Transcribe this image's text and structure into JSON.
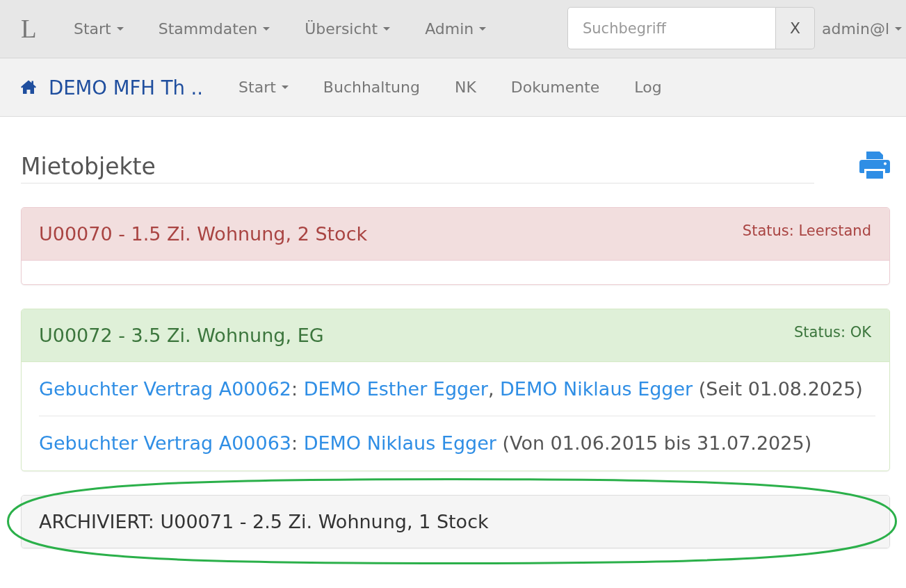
{
  "top_navbar": {
    "brand": "L",
    "items": [
      {
        "label": "Start",
        "dropdown": true
      },
      {
        "label": "Stammdaten",
        "dropdown": true
      },
      {
        "label": "Übersicht",
        "dropdown": true
      },
      {
        "label": "Admin",
        "dropdown": true
      }
    ],
    "search": {
      "placeholder": "Suchbegriff",
      "button": "X"
    },
    "user_menu": {
      "label": "admin@l",
      "dropdown": true
    }
  },
  "project_navbar": {
    "brand": "DEMO MFH Th ..",
    "items": [
      {
        "label": "Start",
        "dropdown": true
      },
      {
        "label": "Buchhaltung",
        "dropdown": false
      },
      {
        "label": "NK",
        "dropdown": false
      },
      {
        "label": "Dokumente",
        "dropdown": false
      },
      {
        "label": "Log",
        "dropdown": false
      }
    ]
  },
  "page": {
    "heading": "Mietobjekte",
    "panels": [
      {
        "kind": "danger",
        "title": "U00070 - 1.5 Zi. Wohnung, 2 Stock",
        "status": "Status: Leerstand",
        "highlighted": false
      },
      {
        "kind": "success",
        "title": "U00072 - 3.5 Zi. Wohnung, EG",
        "status": "Status: OK",
        "highlighted": false,
        "contracts": [
          {
            "parts": [
              {
                "kind": "contract_link",
                "text": "Gebuchter Vertrag A00062"
              },
              {
                "kind": "text",
                "text": ": "
              },
              {
                "kind": "tenant_link",
                "text": "DEMO Esther Egger"
              },
              {
                "kind": "text",
                "text": ", "
              },
              {
                "kind": "tenant_link",
                "text": "DEMO Niklaus Egger"
              },
              {
                "kind": "text",
                "text": " (Seit 01.08.2025)"
              }
            ]
          },
          {
            "parts": [
              {
                "kind": "contract_link",
                "text": "Gebuchter Vertrag A00063"
              },
              {
                "kind": "text",
                "text": ": "
              },
              {
                "kind": "tenant_link",
                "text": "DEMO Niklaus Egger"
              },
              {
                "kind": "text",
                "text": " (Von 01.06.2015 bis 31.07.2025)"
              }
            ]
          }
        ]
      },
      {
        "kind": "archived",
        "title": "ARCHIVIERT: U00071 - 2.5 Zi. Wohnung, 1 Stock",
        "highlighted": true
      }
    ]
  }
}
